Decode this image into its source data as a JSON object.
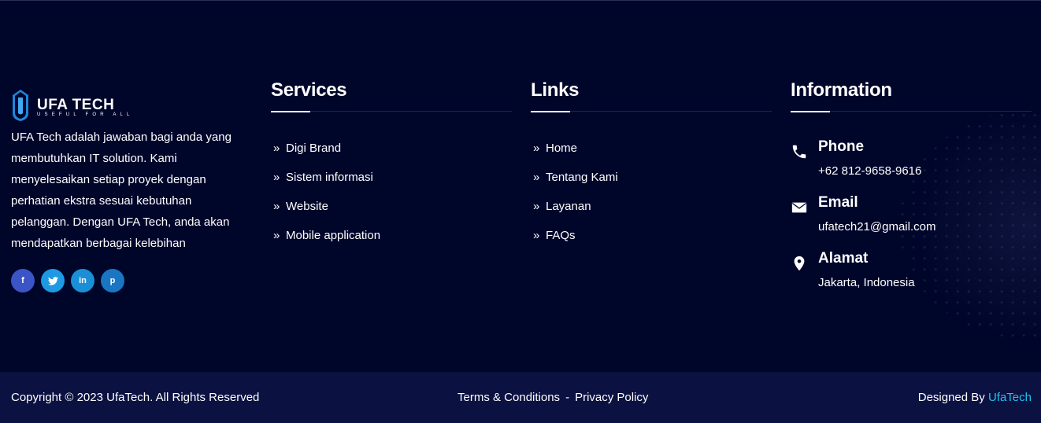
{
  "brand": {
    "name": "UFA TECH",
    "tagline": "USEFUL FOR ALL"
  },
  "about": {
    "text": "UFA Tech adalah jawaban bagi anda yang membutuhkan IT solution. Kami menyelesaikan setiap proyek dengan perhatian ekstra sesuai kebutuhan pelanggan. Dengan UFA Tech, anda akan mendapatkan berbagai kelebihan"
  },
  "socials": [
    {
      "icon": "facebook-icon",
      "glyph": "f",
      "color": "#3b55c6"
    },
    {
      "icon": "twitter-icon",
      "glyph": "t",
      "color": "#1d9ae3"
    },
    {
      "icon": "linkedin-icon",
      "glyph": "in",
      "color": "#1b8fd6"
    },
    {
      "icon": "pinterest-icon",
      "glyph": "p",
      "color": "#1a76c2"
    }
  ],
  "services": {
    "heading": "Services",
    "items": [
      "Digi Brand",
      "Sistem informasi",
      "Website",
      "Mobile application"
    ]
  },
  "links": {
    "heading": "Links",
    "items": [
      "Home",
      "Tentang Kami",
      "Layanan",
      "FAQs"
    ]
  },
  "information": {
    "heading": "Information",
    "phone": {
      "title": "Phone",
      "value": "+62 812-9658-9616",
      "icon": "phone-icon"
    },
    "email": {
      "title": "Email",
      "value": "ufatech21@gmail.com",
      "icon": "envelope-icon"
    },
    "address": {
      "title": "Alamat",
      "value": "Jakarta, Indonesia",
      "icon": "map-pin-icon"
    }
  },
  "bottom": {
    "copyright": "Copyright © 2023 UfaTech. All Rights Reserved",
    "terms": "Terms & Conditions",
    "separator": "-",
    "privacy": "Privacy Policy",
    "designed_prefix": "Designed By",
    "designed_link": "UfaTech"
  },
  "colors": {
    "background": "#00052a",
    "bottom_bar": "#0b1140",
    "accent_link": "#1ec3f0"
  }
}
